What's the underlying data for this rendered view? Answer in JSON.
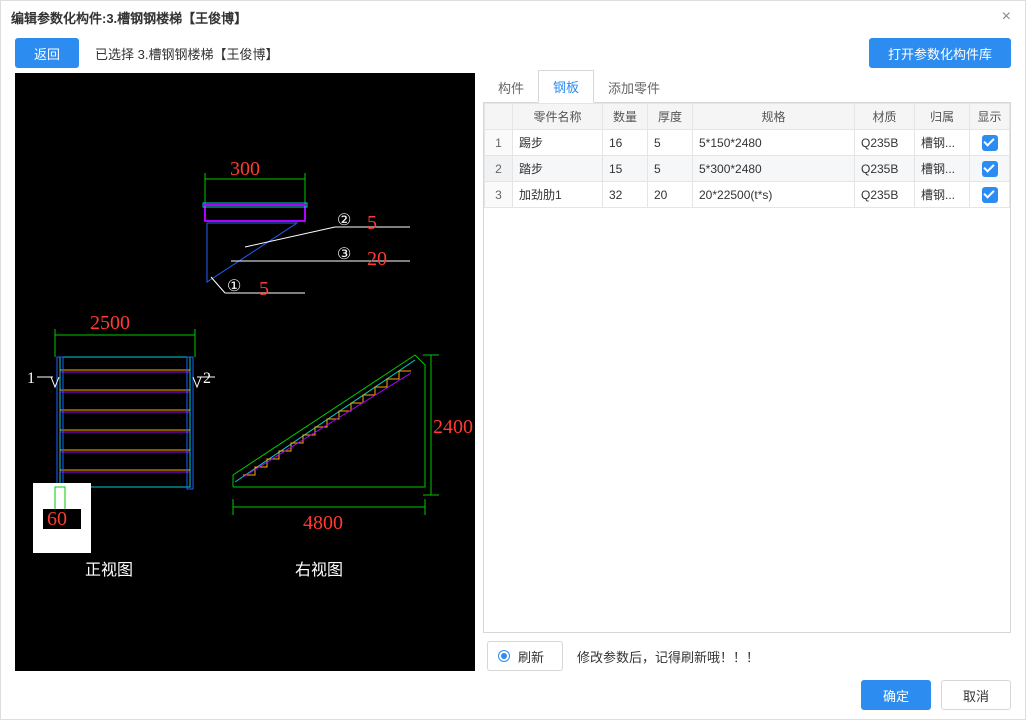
{
  "window": {
    "title": "编辑参数化构件:3.槽钢钢楼梯【王俊博】",
    "close": "×"
  },
  "toolbar": {
    "back": "返回",
    "selected_prefix": "已选择 ",
    "selected_name": "3.槽钢钢楼梯【王俊博】",
    "open_library": "打开参数化构件库"
  },
  "drawing": {
    "dim_300": "300",
    "dim_2500": "2500",
    "dim_2400": "2400",
    "dim_4800": "4800",
    "val_60": "60",
    "mark1": "1",
    "mark2": "2",
    "c1": "①",
    "c2": "②",
    "c3": "③",
    "v5a": "5",
    "v5b": "5",
    "v20": "20",
    "label_front": "正视图",
    "label_right": "右视图"
  },
  "tabs": {
    "t1": "构件",
    "t2": "钢板",
    "t3": "添加零件"
  },
  "table": {
    "headers": {
      "idx": "",
      "name": "零件名称",
      "qty": "数量",
      "thk": "厚度",
      "spec": "规格",
      "mat": "材质",
      "owner": "归属",
      "show": "显示"
    },
    "rows": [
      {
        "idx": "1",
        "name": "踢步",
        "qty": "16",
        "thk": "5",
        "spec": "5*150*2480",
        "mat": "Q235B",
        "owner": "槽钢...",
        "show": true
      },
      {
        "idx": "2",
        "name": "踏步",
        "qty": "15",
        "thk": "5",
        "spec": "5*300*2480",
        "mat": "Q235B",
        "owner": "槽钢...",
        "show": true
      },
      {
        "idx": "3",
        "name": "加劲肋1",
        "qty": "32",
        "thk": "20",
        "spec": "20*22500(t*s)",
        "mat": "Q235B",
        "owner": "槽钢...",
        "show": true
      }
    ]
  },
  "refresh": {
    "button": "刷新",
    "hint": "修改参数后，记得刷新哦！！！"
  },
  "footer": {
    "ok": "确定",
    "cancel": "取消"
  }
}
